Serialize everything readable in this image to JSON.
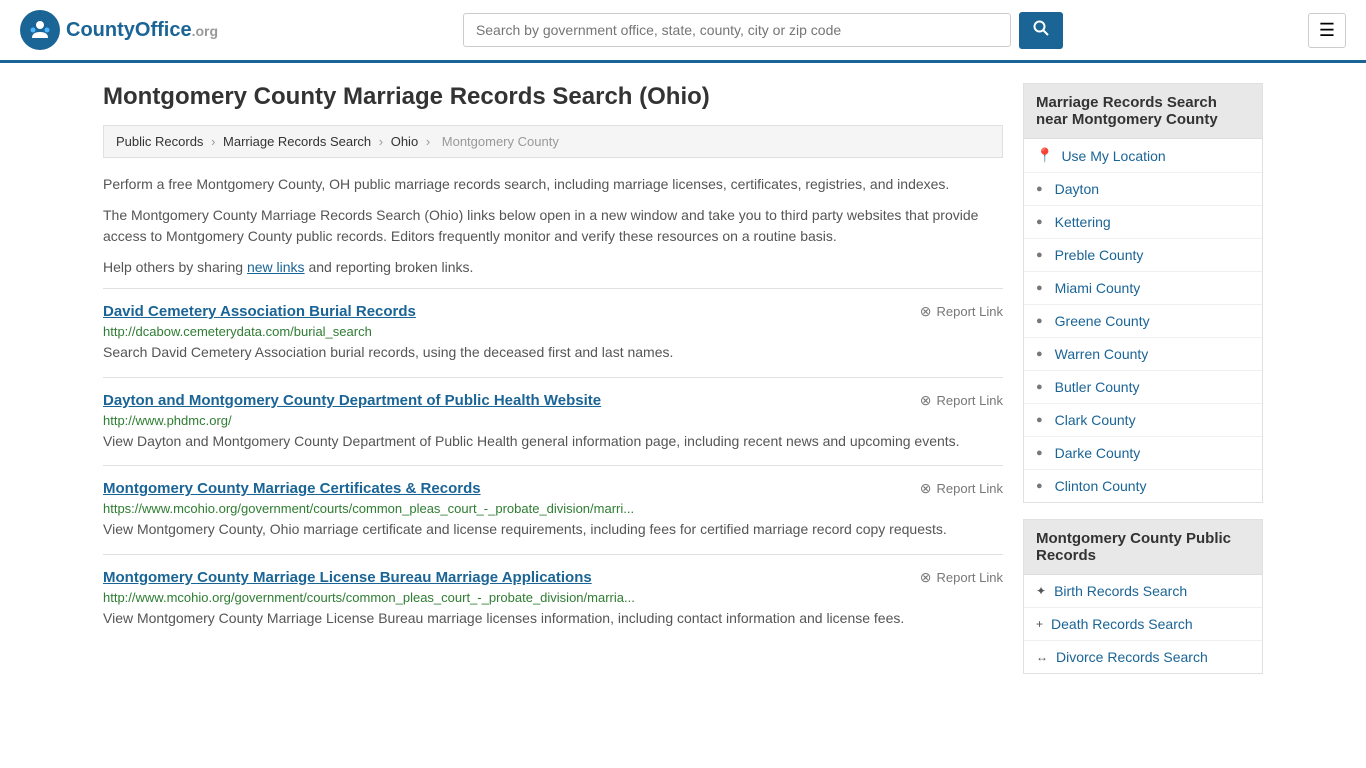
{
  "header": {
    "logo_text": "CountyOffice",
    "logo_suffix": ".org",
    "search_placeholder": "Search by government office, state, county, city or zip code",
    "search_btn_label": "🔍"
  },
  "page": {
    "title": "Montgomery County Marriage Records Search (Ohio)",
    "breadcrumb": [
      "Public Records",
      "Marriage Records Search",
      "Ohio",
      "Montgomery County"
    ]
  },
  "description": {
    "line1": "Perform a free Montgomery County, OH public marriage records search, including marriage licenses, certificates, registries, and indexes.",
    "line2": "The Montgomery County Marriage Records Search (Ohio) links below open in a new window and take you to third party websites that provide access to Montgomery County public records. Editors frequently monitor and verify these resources on a routine basis.",
    "line3_prefix": "Help others by sharing ",
    "line3_link": "new links",
    "line3_suffix": " and reporting broken links."
  },
  "results": [
    {
      "title": "David Cemetery Association Burial Records",
      "url": "http://dcabow.cemeterydata.com/burial_search",
      "description": "Search David Cemetery Association burial records, using the deceased first and last names.",
      "report": "Report Link"
    },
    {
      "title": "Dayton and Montgomery County Department of Public Health Website",
      "url": "http://www.phdmc.org/",
      "description": "View Dayton and Montgomery County Department of Public Health general information page, including recent news and upcoming events.",
      "report": "Report Link"
    },
    {
      "title": "Montgomery County Marriage Certificates & Records",
      "url": "https://www.mcohio.org/government/courts/common_pleas_court_-_probate_division/marri...",
      "description": "View Montgomery County, Ohio marriage certificate and license requirements, including fees for certified marriage record copy requests.",
      "report": "Report Link"
    },
    {
      "title": "Montgomery County Marriage License Bureau Marriage Applications",
      "url": "http://www.mcohio.org/government/courts/common_pleas_court_-_probate_division/marria...",
      "description": "View Montgomery County Marriage License Bureau marriage licenses information, including contact information and license fees.",
      "report": "Report Link"
    }
  ],
  "sidebar": {
    "nearby_section": {
      "title": "Marriage Records Search near Montgomery County",
      "use_location": "Use My Location",
      "links": [
        "Dayton",
        "Kettering",
        "Preble County",
        "Miami County",
        "Greene County",
        "Warren County",
        "Butler County",
        "Clark County",
        "Darke County",
        "Clinton County"
      ]
    },
    "public_records_section": {
      "title": "Montgomery County Public Records",
      "links": [
        {
          "label": "Birth Records Search",
          "icon": "✦"
        },
        {
          "label": "Death Records Search",
          "icon": "+"
        },
        {
          "label": "Divorce Records Search",
          "icon": "↔"
        }
      ]
    }
  }
}
